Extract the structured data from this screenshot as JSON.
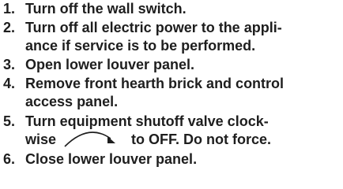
{
  "steps": [
    {
      "num": "1.",
      "lines": [
        "Turn off the wall switch."
      ]
    },
    {
      "num": "2.",
      "lines": [
        "Turn off all electric power to the appli-",
        "ance if service is to be performed."
      ]
    },
    {
      "num": "3.",
      "lines": [
        "Open lower louver panel."
      ]
    },
    {
      "num": "4.",
      "lines": [
        "Remove front hearth brick and control",
        "access panel."
      ]
    },
    {
      "num": "5.",
      "lines": [
        "Turn equipment shutoff valve clock-",
        "wise",
        "to OFF. Do not force."
      ]
    },
    {
      "num": "6.",
      "lines": [
        "Close lower louver panel."
      ]
    }
  ],
  "icons": {
    "clockwise_arrow": "clockwise-arrow-icon"
  },
  "colors": {
    "text": "#1e1e1e"
  }
}
